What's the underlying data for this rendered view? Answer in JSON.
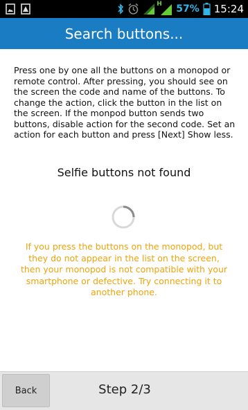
{
  "status_bar": {
    "battery_percent": "57%",
    "time": "15:24",
    "network_type": "H",
    "left_icons": [
      "photo-icon",
      "alert-icon"
    ],
    "right_icons": [
      "bluetooth-icon",
      "alarm-icon",
      "wifi-icon",
      "signal-icon",
      "battery-icon"
    ],
    "accent": "#33b5e5"
  },
  "header": {
    "title": "Search buttons...",
    "background": "#1a7dc4"
  },
  "main": {
    "description": "Press one by one all the buttons on a monopod or remote control. After pressing, you should see on the screen the code and name of the buttons. To change the action, click the button in the list on the screen. If the monpod button sends two buttons, disable action for the second code. Set an action for each button and press [Next] Show less.",
    "status_title": "Selfie buttons not found",
    "warning": "If you press the buttons on the monopod, but they do not appear in the list on the screen, then your monopod is not compatible with your smartphone or defective. Try connecting it to another phone.",
    "warning_color": "#f0a30a"
  },
  "footer": {
    "back_label": "Back",
    "step_label": "Step 2/3"
  }
}
